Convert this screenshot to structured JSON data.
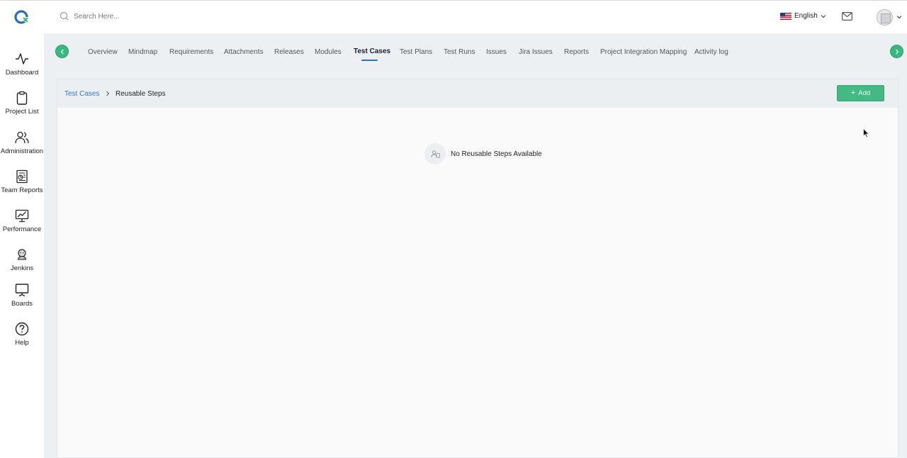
{
  "header": {
    "search_placeholder": "Search Here...",
    "language": "English"
  },
  "sidebar": {
    "items": [
      {
        "label": "Dashboard",
        "icon": "activity-icon"
      },
      {
        "label": "Project List",
        "icon": "clipboard-icon"
      },
      {
        "label": "Administration",
        "icon": "users-icon"
      },
      {
        "label": "Team Reports",
        "icon": "report-icon"
      },
      {
        "label": "Performance",
        "icon": "performance-icon"
      },
      {
        "label": "Jenkins",
        "icon": "jenkins-icon"
      },
      {
        "label": "Boards",
        "icon": "board-icon"
      },
      {
        "label": "Help",
        "icon": "help-icon"
      }
    ]
  },
  "tabs": {
    "items": [
      {
        "label": "Overview"
      },
      {
        "label": "Mindmap"
      },
      {
        "label": "Requirements"
      },
      {
        "label": "Attachments"
      },
      {
        "label": "Releases"
      },
      {
        "label": "Modules"
      },
      {
        "label": "Test Cases"
      },
      {
        "label": "Test Plans"
      },
      {
        "label": "Test Runs"
      },
      {
        "label": "Issues"
      },
      {
        "label": "Jira Issues"
      },
      {
        "label": "Reports"
      },
      {
        "label": "Project Integration Mapping"
      },
      {
        "label": "Activity log"
      }
    ],
    "active": "Test Cases"
  },
  "breadcrumb": {
    "parent": "Test Cases",
    "current": "Reusable Steps"
  },
  "toolbar": {
    "add_label": "Add",
    "add_icon": "+"
  },
  "empty_state": {
    "message": "No Reusable Steps Available"
  },
  "colors": {
    "accent_green": "#45b985",
    "link_blue": "#3578c5",
    "tab_underline": "#2f70b8",
    "main_bg": "#edf0f3"
  }
}
